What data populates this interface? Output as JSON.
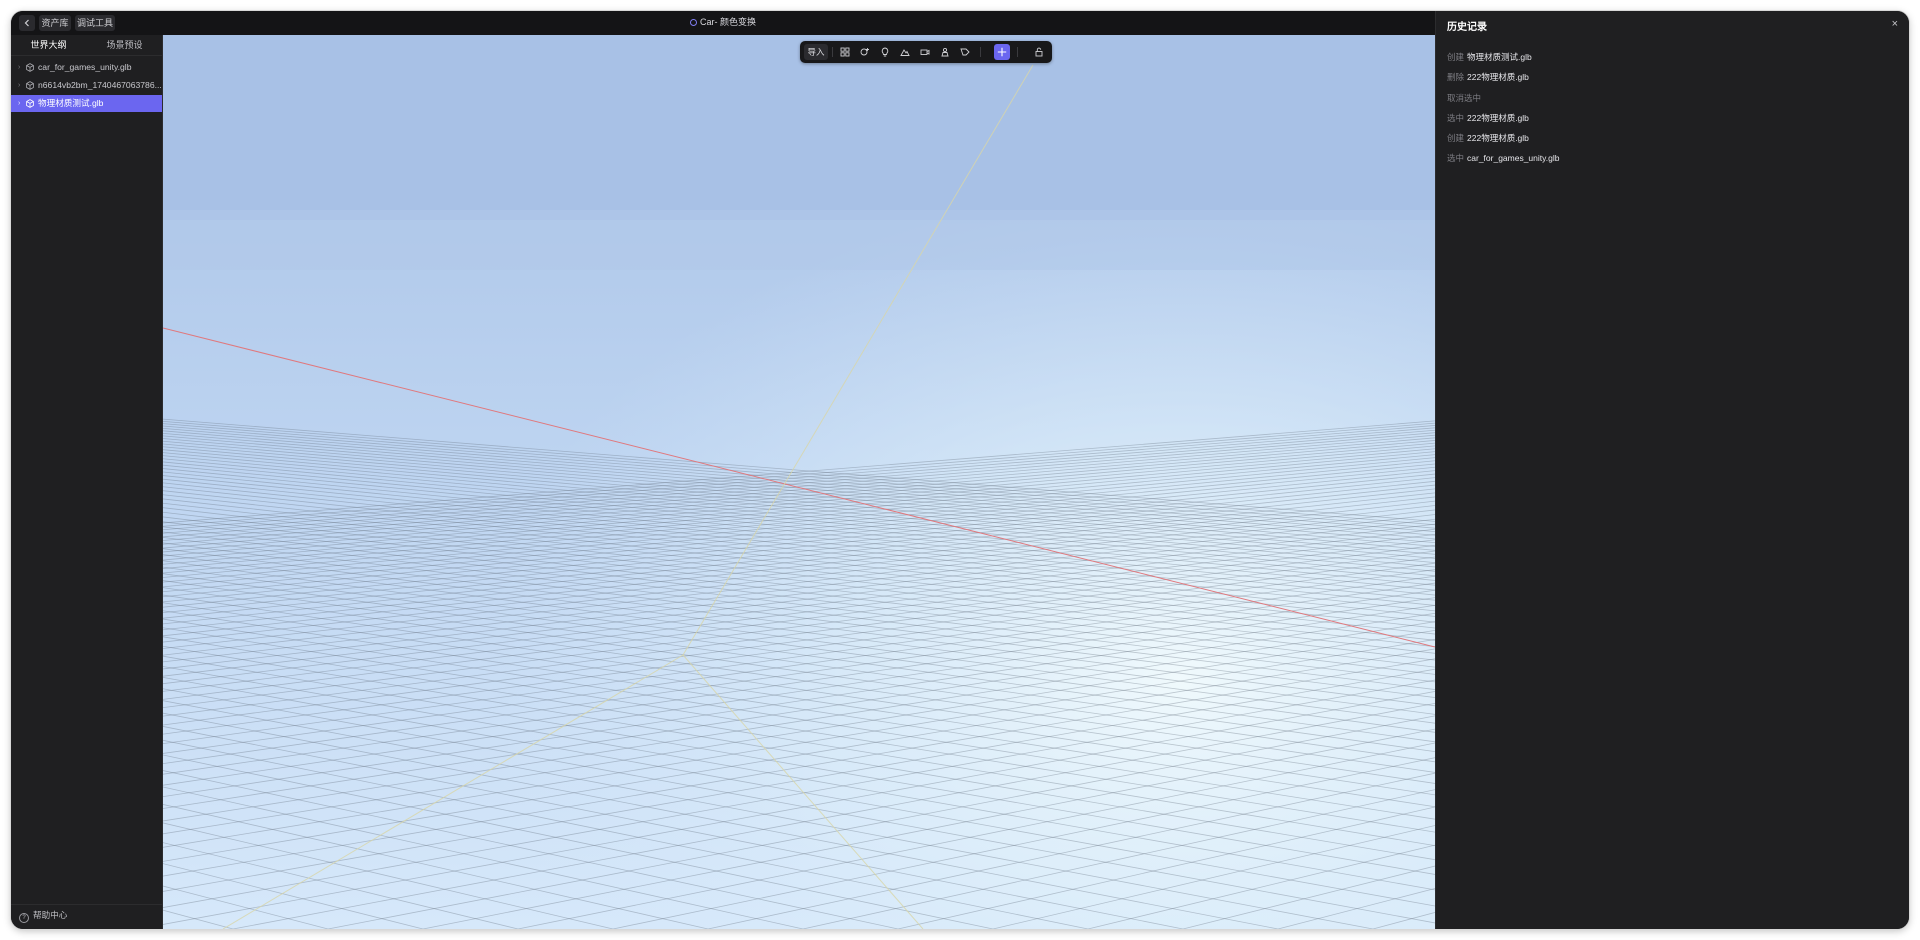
{
  "header": {
    "back_icon": "chevron-left-icon",
    "asset_library": "资产库",
    "debug_tools": "调试工具",
    "scene_title": "Car- 颜色变换"
  },
  "sidebar": {
    "tabs": [
      "世界大纲",
      "场景预设"
    ],
    "tree": [
      {
        "label": "car_for_games_unity.glb",
        "selected": false
      },
      {
        "label": "n6614vb2bm_1740467063786...",
        "selected": false
      },
      {
        "label": "物理材质测试.glb",
        "selected": true
      }
    ],
    "help": "帮助中心"
  },
  "toolbar": {
    "import": "导入",
    "tools": [
      "grid-icon",
      "object-add-icon",
      "light-bulb-icon",
      "terrain-icon",
      "camera-icon",
      "character-icon",
      "label-icon",
      "move-gizmo-icon",
      "lock-icon"
    ],
    "active_tool": "move-gizmo-icon",
    "accent": "#6b66f0"
  },
  "history": {
    "title": "历史记录",
    "close": "×",
    "entries": [
      {
        "action": "创建",
        "target": "物理材质测试.glb"
      },
      {
        "action": "删除",
        "target": "222物理材质.glb"
      },
      {
        "action": "取消选中",
        "target": ""
      },
      {
        "action": "选中",
        "target": "222物理材质.glb"
      },
      {
        "action": "创建",
        "target": "222物理材质.glb"
      },
      {
        "action": "选中",
        "target": "car_for_games_unity.glb"
      }
    ]
  }
}
